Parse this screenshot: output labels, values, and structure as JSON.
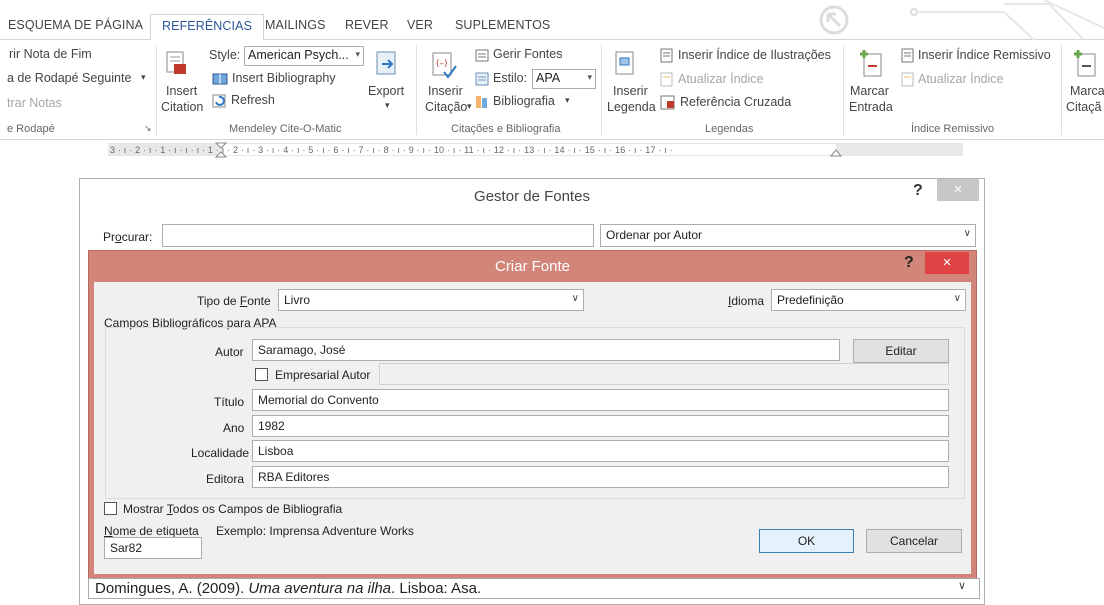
{
  "tabs": [
    "ESQUEMA DE PÁGINA",
    "REFERÊNCIAS",
    "MAILINGS",
    "REVER",
    "VER",
    "SUPLEMENTOS"
  ],
  "ribbon": {
    "footnotes": {
      "item1": "rir Nota de Fim",
      "item2": "a de Rodapé Seguinte",
      "item3": "trar Notas",
      "group": "e Rodapé"
    },
    "mendeley": {
      "style_label": "Style:",
      "style_value": "American Psych...",
      "insert_bibliography": "Insert Bibliography",
      "refresh": "Refresh",
      "insert_citation_1": "Insert",
      "insert_citation_2": "Citation",
      "export": "Export",
      "group": "Mendeley Cite-O-Matic"
    },
    "citations": {
      "inserir_citacao_1": "Inserir",
      "inserir_citacao_2": "Citação",
      "gerir_fontes": "Gerir Fontes",
      "estilo_label": "Estilo:",
      "estilo_value": "APA",
      "bibliografia": "Bibliografia",
      "group": "Citações e Bibliografia"
    },
    "captions": {
      "inserir_legenda_1": "Inserir",
      "inserir_legenda_2": "Legenda",
      "indice_ilustracoes": "Inserir Índice de Ilustrações",
      "atualizar_indice": "Atualizar Índice",
      "referencia_cruzada": "Referência Cruzada",
      "group": "Legendas"
    },
    "index": {
      "marcar_entrada_1": "Marcar",
      "marcar_entrada_2": "Entrada",
      "indice_remissivo": "Inserir Índice Remissivo",
      "atualizar_indice": "Atualizar Índice",
      "group": "Índice Remissivo"
    },
    "toa": {
      "marcar_1": "Marca",
      "marcar_2": "Citaçã"
    }
  },
  "ruler": "3 · ı · 2 · ı · 1 · ı · ı · ı · 1 · ı · 2 · ı · 3 · ı · 4 · ı · 5 · ı · 6 · ı · 7 · ı · 8 · ı · 9 · ı · 10 · ı · 11 · ı · 12 · ı · 13 · ı · 14 · ı · 15 · ı · 16 · ı · 17 · ı ·",
  "gestor": {
    "title": "Gestor de Fontes",
    "help": "?",
    "close": "×",
    "procurar_prefix": "Pr",
    "procurar_key": "o",
    "procurar_suffix": "curar:",
    "search_value": "",
    "sort_value": "Ordenar por Autor",
    "preview_prefix": "Domingues, A. (2009). ",
    "preview_title": "Uma aventura na ilha",
    "preview_suffix": ". Lisboa: Asa."
  },
  "criar": {
    "title": "Criar Fonte",
    "help": "?",
    "close": "×",
    "tipo_prefix": "Tipo de ",
    "tipo_key": "F",
    "tipo_suffix": "onte",
    "tipo_value": "Livro",
    "idioma_key": "I",
    "idioma_suffix": "dioma",
    "idioma_value": "Predefinição",
    "group_label": "Campos Bibliográficos para APA",
    "autor_label": "Autor",
    "autor_value": "Saramago, José",
    "editar": "Editar",
    "empresarial": "Empresarial Autor",
    "titulo_label": "Título",
    "titulo_value": "Memorial do Convento",
    "ano_label": "Ano",
    "ano_value": "1982",
    "localidade_label": "Localidade",
    "localidade_value": "Lisboa",
    "editora_label": "Editora",
    "editora_value": "RBA Editores",
    "mostrar_prefix": "Mostrar ",
    "mostrar_key": "T",
    "mostrar_suffix": "odos os Campos de Bibliografia",
    "etiqueta_key": "N",
    "etiqueta_suffix": "ome de etiqueta",
    "exemplo": "Exemplo: Imprensa Adventure Works",
    "etiqueta_value": "Sar82",
    "ok": "OK",
    "cancelar": "Cancelar"
  },
  "colors": {
    "accent": "#2b579a",
    "dialog_frame": "#d2867a",
    "close_red": "#e04343"
  }
}
